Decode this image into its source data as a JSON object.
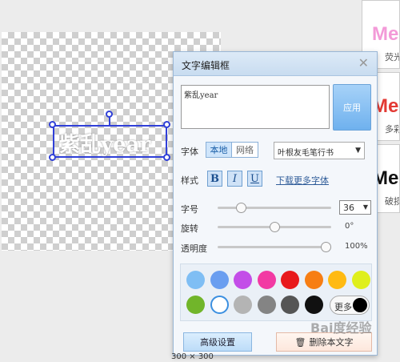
{
  "canvas": {
    "text_preview": "紫乱year"
  },
  "thumbnails": [
    {
      "big": "Mei",
      "small": "荧光",
      "color": "#f39ad8"
    },
    {
      "big": "Mei",
      "small": "多彩",
      "color": "#e33a34"
    },
    {
      "big": "Mei",
      "small": "破损",
      "color": "#111111"
    }
  ],
  "dialog": {
    "title": "文字编辑框",
    "text_value": "紫乱year",
    "apply_label": "应用",
    "font_label": "字体",
    "font_source_local": "本地",
    "font_source_web": "网络",
    "font_selected": "叶根友毛笔行书",
    "style_label": "样式",
    "bold_label": "B",
    "italic_label": "I",
    "underline_label": "U",
    "more_fonts_link": "下载更多字体",
    "size_label": "字号",
    "size_value": "36",
    "rotate_label": "旋转",
    "rotate_value": "0°",
    "opacity_label": "透明度",
    "opacity_value": "100%",
    "size_slider_fraction": 0.18,
    "rotate_slider_fraction": 0.5,
    "opacity_slider_fraction": 1.0,
    "colors_row1": [
      "#7fbef4",
      "#6a9ef0",
      "#c34ee8",
      "#f23aa3",
      "#e8191c",
      "#f77e14",
      "#ffba12",
      "#dfef1c"
    ],
    "colors_row2": [
      "#71b52a",
      "#ffffff",
      "#b4b4b4",
      "#848484",
      "#555555",
      "#111111"
    ],
    "more_colors_label": "更多",
    "advanced_label": "高级设置",
    "delete_label": "删除本文字"
  },
  "status": {
    "text": "300 × 300"
  },
  "watermark": "Bai度经验"
}
